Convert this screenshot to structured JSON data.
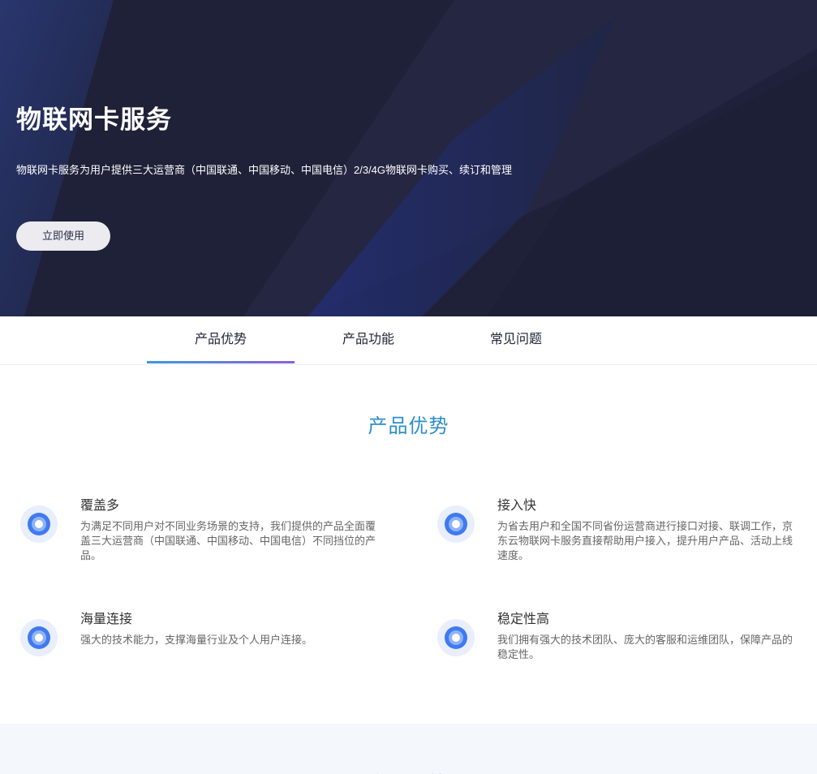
{
  "hero": {
    "title": "物联网卡服务",
    "description": "物联网卡服务为用户提供三大运营商（中国联通、中国移动、中国电信）2/3/4G物联网卡购买、续订和管理",
    "cta_label": "立即使用"
  },
  "tabs": [
    {
      "label": "产品优势",
      "active": true
    },
    {
      "label": "产品功能",
      "active": false
    },
    {
      "label": "常见问题",
      "active": false
    }
  ],
  "advantages": {
    "title": "产品优势",
    "items": [
      {
        "title": "覆盖多",
        "desc": "为满足不同用户对不同业务场景的支持，我们提供的产品全面覆盖三大运营商（中国联通、中国移动、中国电信）不同挡位的产品。",
        "icon": "target-circle-icon"
      },
      {
        "title": "接入快",
        "desc": "为省去用户和全国不同省份运营商进行接口对接、联调工作，京东云物联网卡服务直接帮助用户接入，提升用户产品、活动上线速度。",
        "icon": "target-circle-icon"
      },
      {
        "title": "海量连接",
        "desc": "强大的技术能力，支撑海量行业及个人用户连接。",
        "icon": "target-circle-icon"
      },
      {
        "title": "稳定性高",
        "desc": "我们拥有强大的技术团队、庞大的客服和运维团队，保障产品的稳定性。",
        "icon": "target-circle-icon"
      }
    ]
  },
  "features_section": {
    "title": "产品功能"
  },
  "colors": {
    "hero_bg": "#20233d",
    "accent": "#2d8ec8",
    "tab_underline_start": "#3a9bdc",
    "tab_underline_end": "#8e5ed8"
  }
}
